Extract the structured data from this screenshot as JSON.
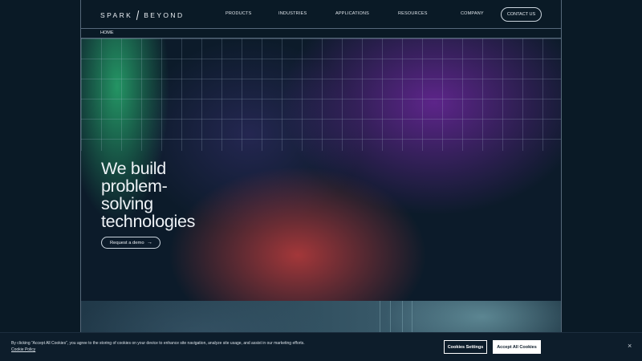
{
  "header": {
    "logo": "SPARK BEYOND",
    "logo_left": "SPARK",
    "logo_right": "BEYOND",
    "nav": [
      "PRODUCTS",
      "INDUSTRIES",
      "APPLICATIONS",
      "RESOURCES",
      "COMPANY"
    ],
    "contact_label": "CONTACT US"
  },
  "breadcrumb": {
    "home": "HOME"
  },
  "hero": {
    "headline_lines": [
      "We build",
      "problem-",
      "solving",
      "technologies"
    ],
    "cta_label": "Request a demo"
  },
  "cookie_banner": {
    "text": "By clicking “Accept All Cookies”, you agree to the storing of cookies on your device to enhance site navigation, analyze site usage, and assist in our marketing efforts.",
    "policy_link": "Cookie Policy",
    "settings_label": "Cookies Settings",
    "accept_label": "Accept All Cookies",
    "close_symbol": "×"
  },
  "colors": {
    "background": "#0a1a26",
    "green_glow": "#28aa6e",
    "purple_glow": "#7828aa",
    "red_glow": "#be3c3c",
    "border": "#56687a"
  }
}
